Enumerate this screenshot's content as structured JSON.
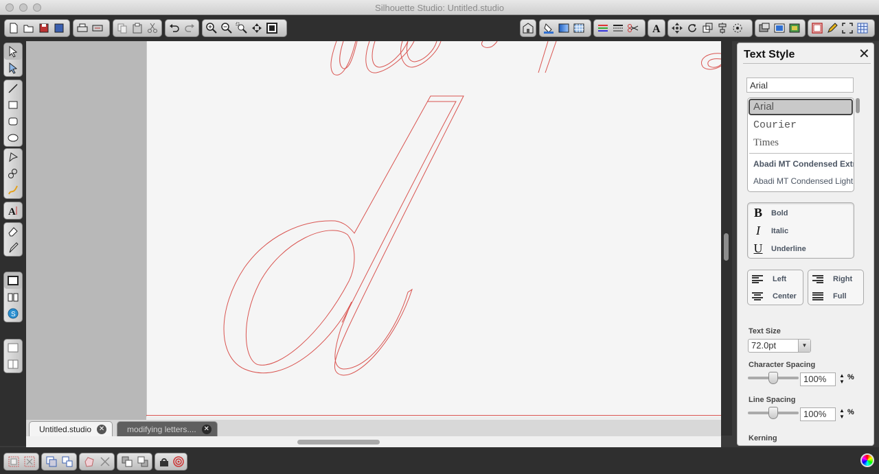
{
  "window": {
    "title": "Silhouette Studio: Untitled.studio"
  },
  "toolbar": {
    "groups": [
      [
        "new-file-icon",
        "open-file-icon",
        "save-icon",
        "save-to-library-icon"
      ],
      [
        "print-icon",
        "cut-send-icon"
      ],
      [
        "copy-icon",
        "paste-icon",
        "cut-icon"
      ],
      [
        "undo-icon",
        "redo-icon"
      ],
      [
        "zoom-in-icon",
        "zoom-out-icon",
        "zoom-selection-icon",
        "pan-icon",
        "fit-page-icon"
      ]
    ],
    "right_groups": [
      [
        "store-icon"
      ],
      [
        "fill-color-icon",
        "gradient-icon",
        "pattern-icon"
      ],
      [
        "line-color-icon",
        "line-style-icon",
        "cut-settings-icon"
      ],
      [
        "text-style-icon"
      ],
      [
        "transform-icon",
        "rotate-icon",
        "scale-icon",
        "align-icon",
        "replicate-icon"
      ],
      [
        "offset-icon",
        "trace-icon",
        "layers-icon"
      ],
      [
        "page-setup-icon",
        "sketch-icon",
        "fullscreen-icon",
        "grid-icon"
      ]
    ]
  },
  "lefttools": {
    "groups": [
      [
        "select-icon",
        "edit-points-icon"
      ],
      [
        "line-tool-icon",
        "rectangle-tool-icon",
        "rounded-rect-tool-icon",
        "ellipse-tool-icon"
      ],
      [
        "polygon-tool-icon",
        "curve-tool-icon",
        "freehand-tool-icon"
      ],
      [
        "text-tool-icon"
      ],
      [
        "eraser-icon",
        "knife-icon"
      ],
      [
        "design-page-icon",
        "library-icon",
        "online-store-icon"
      ],
      [
        "show-page-icon",
        "split-view-icon"
      ]
    ]
  },
  "tabs": [
    {
      "label": "Untitled.studio",
      "active": true
    },
    {
      "label": "modifying letters....",
      "active": false
    }
  ],
  "panel": {
    "title": "Text Style",
    "font_search_value": "Arial",
    "fonts": [
      "Arial",
      "Courier",
      "Times",
      "Abadi MT Condensed Extr",
      "Abadi MT Condensed Light"
    ],
    "selected_font": "Arial",
    "styles": [
      {
        "glyph": "B",
        "label": "Bold"
      },
      {
        "glyph": "I",
        "label": "Italic"
      },
      {
        "glyph": "U",
        "label": "Underline"
      }
    ],
    "alignment": {
      "left": "Left",
      "center": "Center",
      "right": "Right",
      "full": "Full"
    },
    "text_size_label": "Text Size",
    "text_size_value": "72.0pt",
    "char_spacing_label": "Character Spacing",
    "char_spacing_value": "100%",
    "char_spacing_slider_fraction": 0.5,
    "line_spacing_label": "Line Spacing",
    "line_spacing_value": "100%",
    "line_spacing_slider_fraction": 0.5,
    "percent_sign": "%",
    "kerning_label": "Kerning"
  },
  "colors": {
    "cut_line": "#d9534f",
    "accent": "#2f6fd0"
  }
}
